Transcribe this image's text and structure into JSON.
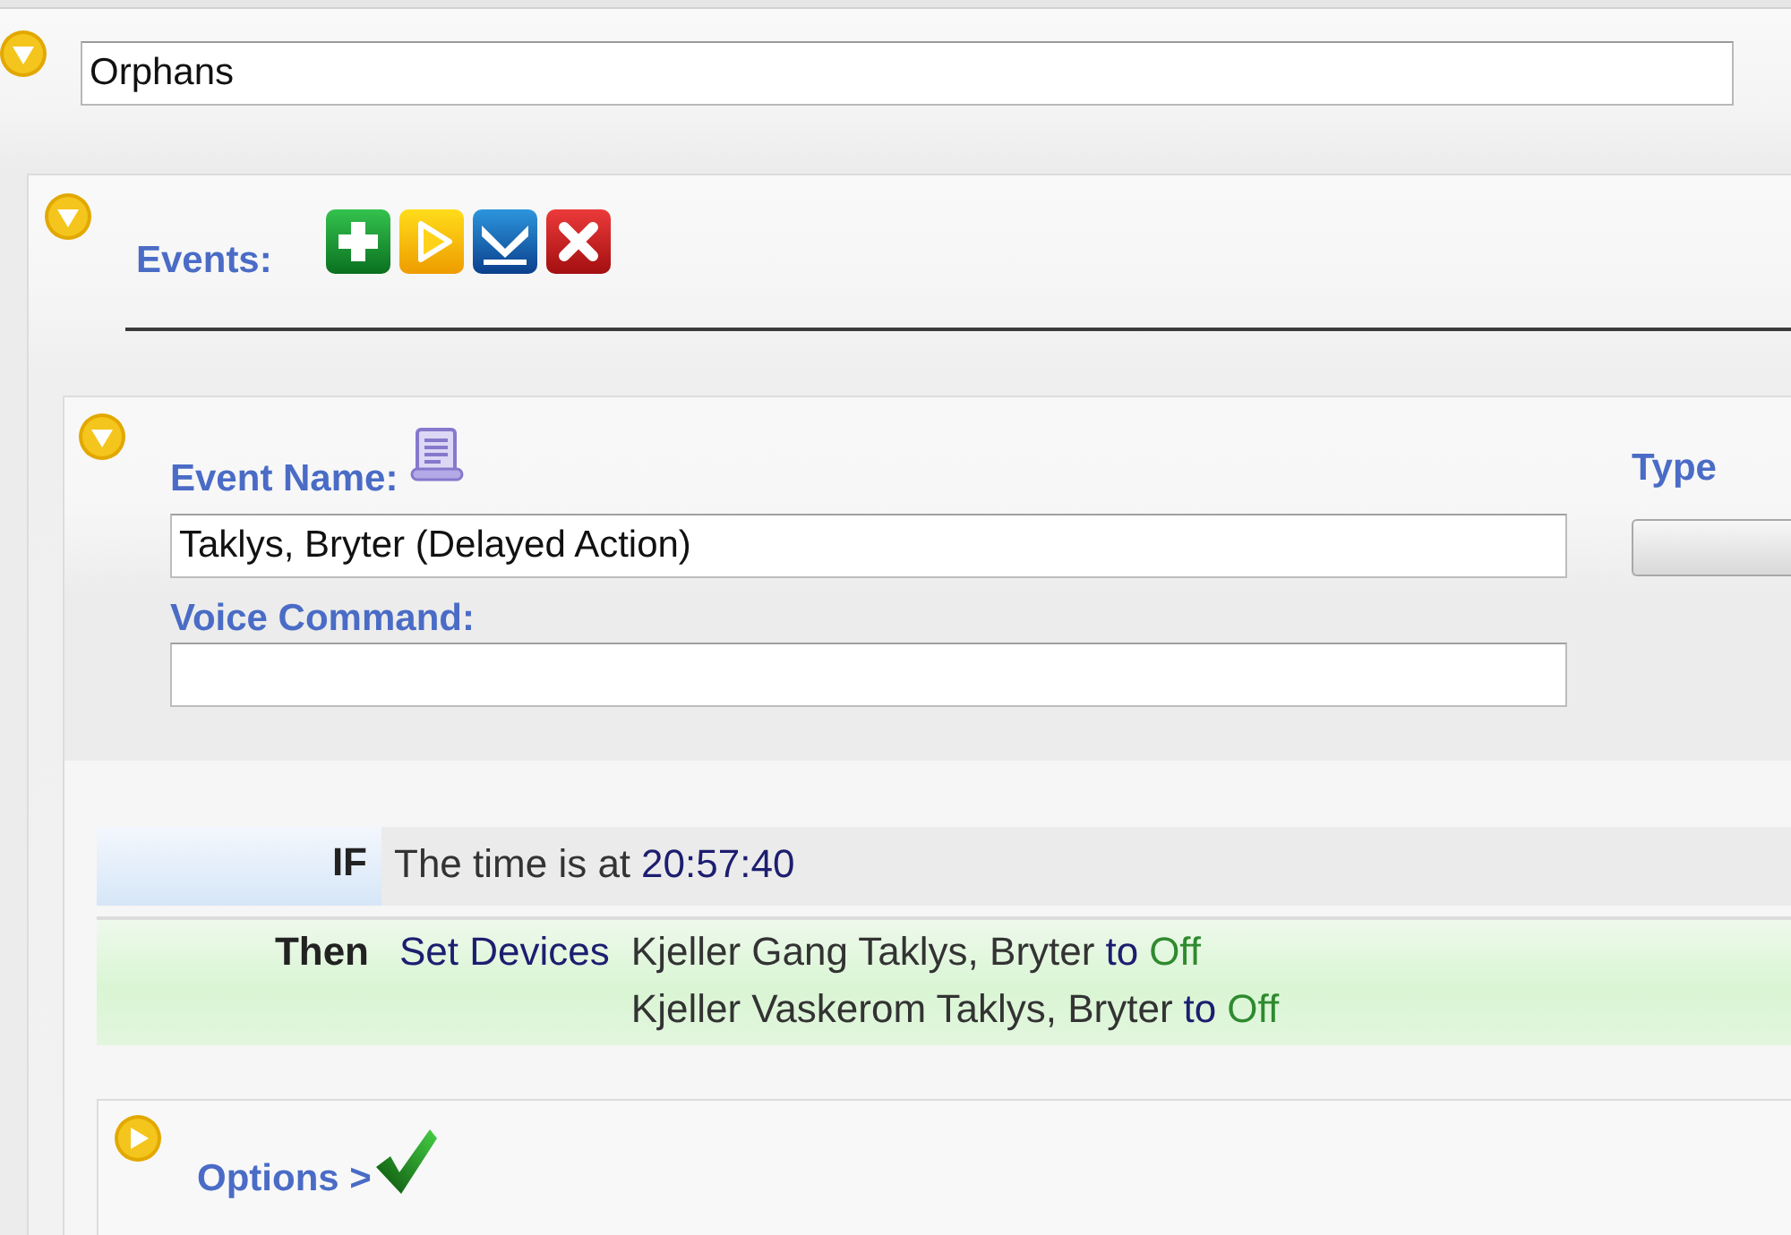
{
  "group": {
    "name": "Orphans",
    "expanded": true
  },
  "events": {
    "label": "Events:",
    "expanded": true
  },
  "event": {
    "expanded": true,
    "name_label": "Event Name:",
    "name": "Taklys, Bryter (Delayed Action)",
    "voice_label": "Voice Command:",
    "type_label": "Type"
  },
  "rules": [
    {
      "kind": "condition",
      "keyword": "IF",
      "text": "The time is at",
      "value": "20:57:40"
    },
    {
      "kind": "action",
      "keyword": "Then",
      "verb": "Set Devices",
      "targets": [
        {
          "device": "Kjeller Gang Taklys, Bryter",
          "connector": "to",
          "state": "Off"
        },
        {
          "device": "Kjeller Vaskerom Taklys, Bryter",
          "connector": "to",
          "state": "Off"
        }
      ]
    }
  ],
  "options": {
    "label": "Options >",
    "expanded": false
  }
}
